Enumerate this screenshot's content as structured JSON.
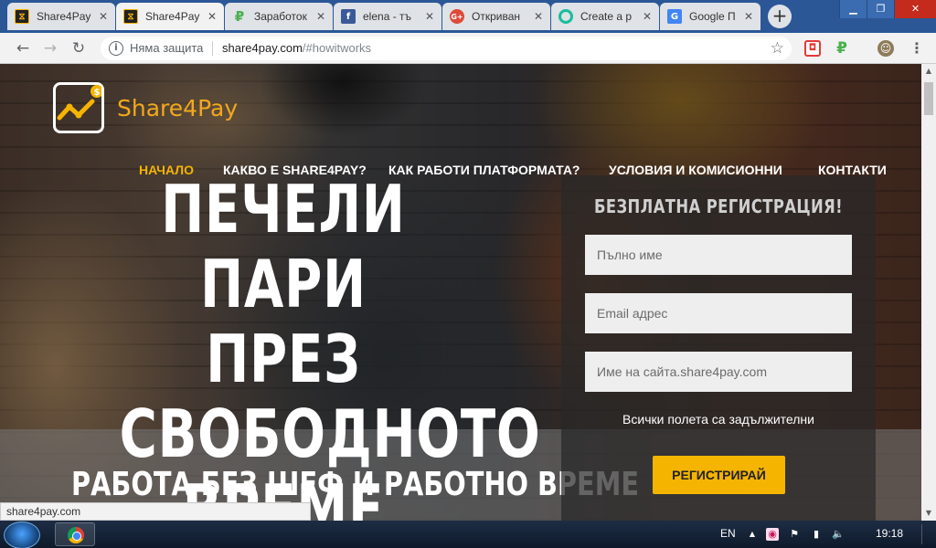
{
  "browser": {
    "tabs": [
      {
        "title": "Share4Pay",
        "favicon": "share4pay-icon",
        "color": "#f5b400"
      },
      {
        "title": "Share4Pay",
        "favicon": "share4pay-icon",
        "color": "#f5b400"
      },
      {
        "title": "Заработок",
        "favicon": "ruble-icon",
        "color": "#4caf50"
      },
      {
        "title": "elena - тъ",
        "favicon": "facebook-icon",
        "color": "#3b5998"
      },
      {
        "title": "Откриван",
        "favicon": "google-plus-icon",
        "color": "#dd4b39"
      },
      {
        "title": "Create a p",
        "favicon": "loop-icon",
        "color": "#1abc9c"
      },
      {
        "title": "Google П",
        "favicon": "google-translate-icon",
        "color": "#4285f4"
      }
    ],
    "address": {
      "security": "Няма защита",
      "host": "share4pay.com",
      "path": "/#howitworks"
    }
  },
  "site": {
    "logo": {
      "accent": "Share",
      "mid": "4",
      "end": "Pay"
    },
    "nav": [
      "НАЧАЛО",
      "КАКВО Е SHARE4PAY?",
      "КАК РАБОТИ ПЛАТФОРМАТА?",
      "УСЛОВИЯ И КОМИСИОННИ",
      "КОНТАКТИ"
    ],
    "headline": [
      "ПЕЧЕЛИ ПАРИ",
      "ПРЕЗ",
      "СВОБОДНОТО",
      "ВРЕМЕ"
    ],
    "subline": "РАБОТА БЕЗ ШЕФ И РАБОТНО ВРЕМЕ",
    "register": {
      "title": "БЕЗПЛАТНА РЕГИСТРАЦИЯ!",
      "name_placeholder": "Пълно име",
      "email_placeholder": "Email адрес",
      "site_placeholder": "Име на сайта.share4pay.com",
      "note": "Всички полета са задължителни",
      "button": "РЕГИСТРИРАЙ"
    },
    "accent_color": "#f5b400"
  },
  "status_url": "share4pay.com",
  "taskbar": {
    "language": "EN",
    "clock": "19:18"
  }
}
